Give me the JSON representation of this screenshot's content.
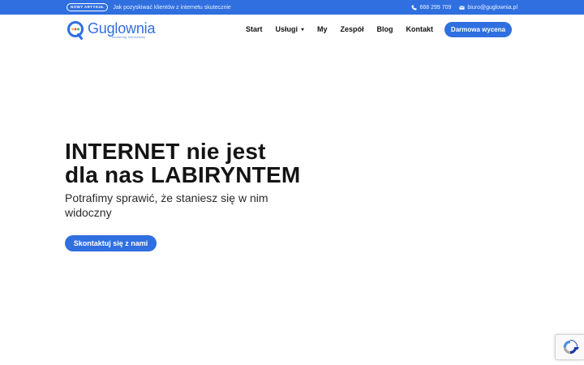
{
  "topbar": {
    "badge": "NOWY ARTYKUŁ",
    "article_link": "Jak pozyskiwać klientów z internetu skutecznie",
    "phone": "668 299 709",
    "email": "biuro@guglownia.pl",
    "phone_icon": "phone-icon",
    "email_icon": "envelope-icon"
  },
  "header": {
    "logo_text": "Guglownia",
    "logo_tagline": "marketing internetowy",
    "nav": [
      {
        "label": "Start"
      },
      {
        "label": "Usługi",
        "has_dropdown": true
      },
      {
        "label": "My"
      },
      {
        "label": "Zespół"
      },
      {
        "label": "Blog"
      },
      {
        "label": "Kontakt"
      }
    ],
    "cta_label": "Darmowa wycena"
  },
  "hero": {
    "title_line1": "INTERNET nie jest",
    "title_line2": "dla nas LABIRYNTEM",
    "subtitle": "Potrafimy sprawić, że staniesz się w nim widoczny",
    "cta_label": "Skontaktuj się z nami"
  },
  "colors": {
    "brand": "#2f6fe0",
    "text": "#141414",
    "background": "#ffffff"
  },
  "recaptcha_icon": "recaptcha-icon"
}
